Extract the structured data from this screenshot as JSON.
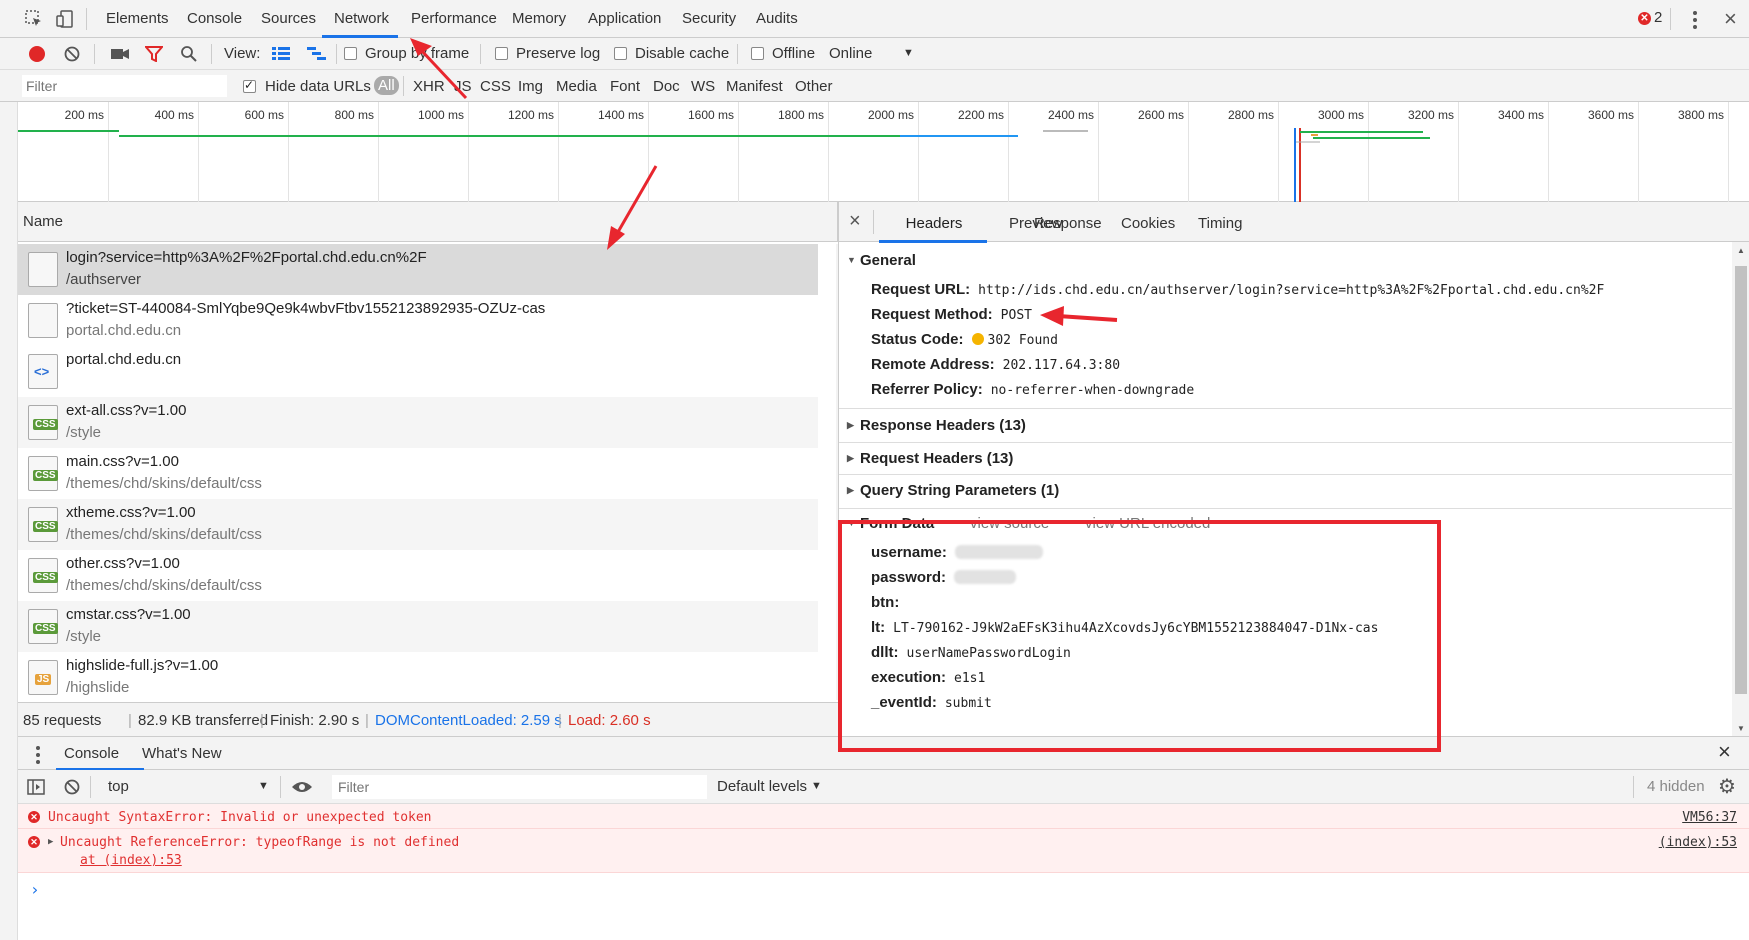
{
  "topbar": {
    "tabs": [
      "Elements",
      "Console",
      "Sources",
      "Network",
      "Performance",
      "Memory",
      "Application",
      "Security",
      "Audits"
    ],
    "active_tab": "Network",
    "error_count": "2"
  },
  "toolbar": {
    "view_label": "View:",
    "group_by_frame": "Group by frame",
    "preserve_log": "Preserve log",
    "disable_cache": "Disable cache",
    "offline": "Offline",
    "throttle": "Online"
  },
  "filterbar": {
    "placeholder": "Filter",
    "hide_data_urls": "Hide data URLs",
    "types": [
      "All",
      "XHR",
      "JS",
      "CSS",
      "Img",
      "Media",
      "Font",
      "Doc",
      "WS",
      "Manifest",
      "Other"
    ]
  },
  "overview": {
    "ticks": [
      "200 ms",
      "400 ms",
      "600 ms",
      "800 ms",
      "1000 ms",
      "1200 ms",
      "1400 ms",
      "1600 ms",
      "1800 ms",
      "2000 ms",
      "2200 ms",
      "2400 ms",
      "2600 ms",
      "2800 ms",
      "3000 ms",
      "3200 ms",
      "3400 ms",
      "3600 ms",
      "3800 ms"
    ]
  },
  "requests": {
    "header": "Name",
    "rows": [
      {
        "name": "login?service=http%3A%2F%2Fportal.chd.edu.cn%2F",
        "path": "/authserver",
        "type": "blank"
      },
      {
        "name": "?ticket=ST-440084-SmlYqbe9Qe9k4wbvFtbv1552123892935-OZUz-cas",
        "path": "portal.chd.edu.cn",
        "type": "blank"
      },
      {
        "name": "portal.chd.edu.cn",
        "path": "",
        "type": "doc"
      },
      {
        "name": "ext-all.css?v=1.00",
        "path": "/style",
        "type": "css"
      },
      {
        "name": "main.css?v=1.00",
        "path": "/themes/chd/skins/default/css",
        "type": "css"
      },
      {
        "name": "xtheme.css?v=1.00",
        "path": "/themes/chd/skins/default/css",
        "type": "css"
      },
      {
        "name": "other.css?v=1.00",
        "path": "/themes/chd/skins/default/css",
        "type": "css"
      },
      {
        "name": "cmstar.css?v=1.00",
        "path": "/style",
        "type": "css"
      },
      {
        "name": "highslide-full.js?v=1.00",
        "path": "/highslide",
        "type": "js"
      }
    ]
  },
  "status": {
    "requests": "85 requests",
    "transferred": "82.9 KB transferred",
    "finish": "Finish: 2.90 s",
    "dom": "DOMContentLoaded: 2.59 s",
    "load": "Load: 2.60 s"
  },
  "details": {
    "tabs": [
      "Headers",
      "Preview",
      "Response",
      "Cookies",
      "Timing"
    ],
    "active_tab": "Headers",
    "general_title": "General",
    "general": [
      {
        "key": "Request URL:",
        "value": "http://ids.chd.edu.cn/authserver/login?service=http%3A%2F%2Fportal.chd.edu.cn%2F"
      },
      {
        "key": "Request Method:",
        "value": "POST"
      },
      {
        "key": "Status Code:",
        "value": "302 Found"
      },
      {
        "key": "Remote Address:",
        "value": "202.117.64.3:80"
      },
      {
        "key": "Referrer Policy:",
        "value": "no-referrer-when-downgrade"
      }
    ],
    "response_headers": "Response Headers (13)",
    "request_headers": "Request Headers (13)",
    "query_string": "Query String Parameters (1)",
    "form_data_title": "Form Data",
    "view_source": "view source",
    "view_url_encoded": "view URL encoded",
    "form_data": [
      {
        "key": "username:",
        "value": ""
      },
      {
        "key": "password:",
        "value": ""
      },
      {
        "key": "btn:",
        "value": ""
      },
      {
        "key": "lt:",
        "value": "LT-790162-J9kW2aEFsK3ihu4AzXcovdsJy6cYBM1552123884047-D1Nx-cas"
      },
      {
        "key": "dllt:",
        "value": "userNamePasswordLogin"
      },
      {
        "key": "execution:",
        "value": "e1s1"
      },
      {
        "key": "_eventId:",
        "value": "submit"
      }
    ]
  },
  "drawer": {
    "tabs": [
      "Console",
      "What's New"
    ],
    "context": "top",
    "filter_placeholder": "Filter",
    "levels": "Default levels",
    "hidden": "4 hidden",
    "errors": [
      {
        "message": "Uncaught SyntaxError: Invalid or unexpected token",
        "source": "VM56:37"
      },
      {
        "message": "Uncaught ReferenceError: typeofRange is not defined",
        "trace": "at (index):53",
        "source": "(index):53"
      }
    ],
    "prompt": "›"
  },
  "colors": {
    "accent": "#1a73e8",
    "error": "#e02828",
    "annotation": "#e8262e",
    "dom_loaded": "#1a73e8",
    "load": "#d93025"
  }
}
